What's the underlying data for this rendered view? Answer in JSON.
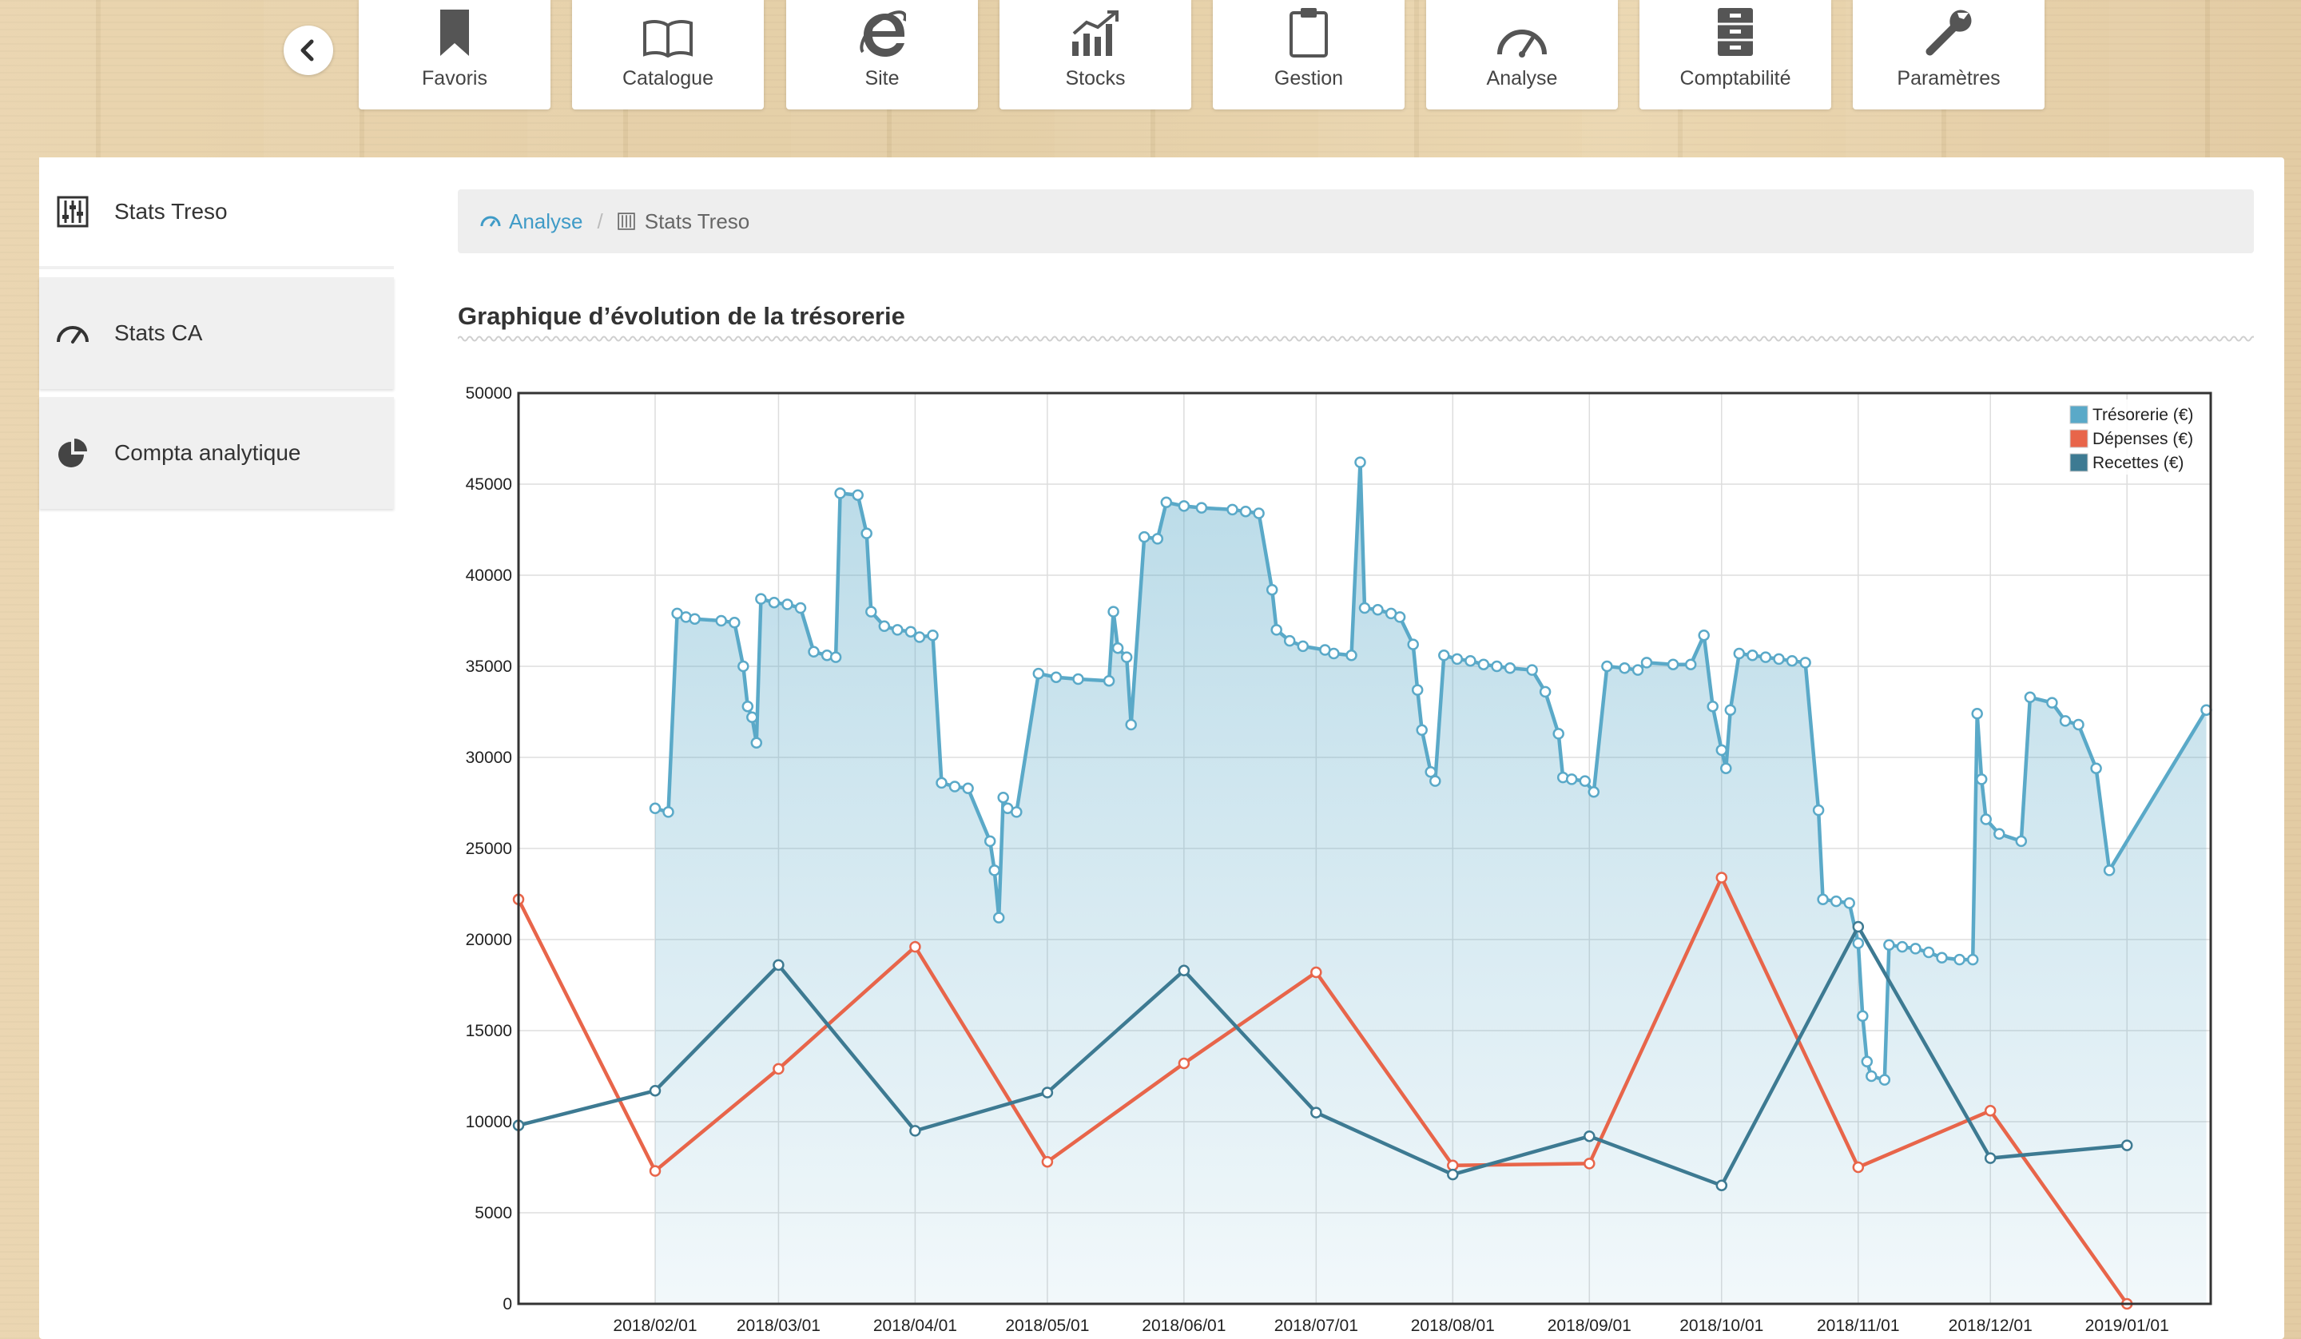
{
  "topnav": {
    "items": [
      {
        "label": "Favoris",
        "icon": "bookmark-icon"
      },
      {
        "label": "Catalogue",
        "icon": "book-icon"
      },
      {
        "label": "Site",
        "icon": "internet-explorer-icon"
      },
      {
        "label": "Stocks",
        "icon": "bar-chart-rising-icon"
      },
      {
        "label": "Gestion",
        "icon": "clipboard-icon"
      },
      {
        "label": "Analyse",
        "icon": "gauge-icon"
      },
      {
        "label": "Comptabilité",
        "icon": "archive-cabinet-icon"
      },
      {
        "label": "Paramètres",
        "icon": "wrench-icon"
      }
    ]
  },
  "sidebar": {
    "items": [
      {
        "label": "Stats Treso",
        "icon": "sliders-icon",
        "active": true
      },
      {
        "label": "Stats CA",
        "icon": "gauge-icon",
        "active": false
      },
      {
        "label": "Compta analytique",
        "icon": "pie-chart-icon",
        "active": false
      }
    ]
  },
  "breadcrumb": {
    "parent": "Analyse",
    "separator": "/",
    "current": "Stats Treso"
  },
  "section": {
    "title": "Graphique d’évolution de la trésorerie"
  },
  "colors": {
    "tresorerie": "#5aa9c8",
    "depenses": "#e8654a",
    "recettes": "#3d7a92",
    "link": "#3f9bc7"
  },
  "chart_data": {
    "type": "line",
    "x_axis_type": "date",
    "xlim": [
      "2018-01-01",
      "2019-01-20"
    ],
    "ylim": [
      0,
      50000
    ],
    "yticks": [
      0,
      5000,
      10000,
      15000,
      20000,
      25000,
      30000,
      35000,
      40000,
      45000,
      50000
    ],
    "xtick_labels": [
      "2018/02/01",
      "2018/03/01",
      "2018/04/01",
      "2018/05/01",
      "2018/06/01",
      "2018/07/01",
      "2018/08/01",
      "2018/09/01",
      "2018/10/01",
      "2018/11/01",
      "2018/12/01",
      "2019/01/01"
    ],
    "grid": true,
    "legend_position": "top-right",
    "series": [
      {
        "name": "Trésorerie (€)",
        "style": "area",
        "points": [
          [
            "2018-02-01",
            27200
          ],
          [
            "2018-02-04",
            27000
          ],
          [
            "2018-02-06",
            37900
          ],
          [
            "2018-02-08",
            37700
          ],
          [
            "2018-02-10",
            37600
          ],
          [
            "2018-02-16",
            37500
          ],
          [
            "2018-02-19",
            37400
          ],
          [
            "2018-02-21",
            35000
          ],
          [
            "2018-02-22",
            32800
          ],
          [
            "2018-02-23",
            32200
          ],
          [
            "2018-02-24",
            30800
          ],
          [
            "2018-02-25",
            38700
          ],
          [
            "2018-02-28",
            38500
          ],
          [
            "2018-03-03",
            38400
          ],
          [
            "2018-03-06",
            38200
          ],
          [
            "2018-03-09",
            35800
          ],
          [
            "2018-03-12",
            35600
          ],
          [
            "2018-03-14",
            35500
          ],
          [
            "2018-03-15",
            44500
          ],
          [
            "2018-03-19",
            44400
          ],
          [
            "2018-03-21",
            42300
          ],
          [
            "2018-03-22",
            38000
          ],
          [
            "2018-03-25",
            37200
          ],
          [
            "2018-03-28",
            37000
          ],
          [
            "2018-03-31",
            36900
          ],
          [
            "2018-04-02",
            36600
          ],
          [
            "2018-04-05",
            36700
          ],
          [
            "2018-04-07",
            28600
          ],
          [
            "2018-04-10",
            28400
          ],
          [
            "2018-04-13",
            28300
          ],
          [
            "2018-04-18",
            25400
          ],
          [
            "2018-04-19",
            23800
          ],
          [
            "2018-04-20",
            21200
          ],
          [
            "2018-04-21",
            27800
          ],
          [
            "2018-04-22",
            27200
          ],
          [
            "2018-04-24",
            27000
          ],
          [
            "2018-04-29",
            34600
          ],
          [
            "2018-05-03",
            34400
          ],
          [
            "2018-05-08",
            34300
          ],
          [
            "2018-05-15",
            34200
          ],
          [
            "2018-05-16",
            38000
          ],
          [
            "2018-05-17",
            36000
          ],
          [
            "2018-05-19",
            35500
          ],
          [
            "2018-05-20",
            31800
          ],
          [
            "2018-05-23",
            42100
          ],
          [
            "2018-05-26",
            42000
          ],
          [
            "2018-05-28",
            44000
          ],
          [
            "2018-06-01",
            43800
          ],
          [
            "2018-06-05",
            43700
          ],
          [
            "2018-06-12",
            43600
          ],
          [
            "2018-06-15",
            43500
          ],
          [
            "2018-06-18",
            43400
          ],
          [
            "2018-06-21",
            39200
          ],
          [
            "2018-06-22",
            37000
          ],
          [
            "2018-06-25",
            36400
          ],
          [
            "2018-06-28",
            36100
          ],
          [
            "2018-07-03",
            35900
          ],
          [
            "2018-07-05",
            35700
          ],
          [
            "2018-07-09",
            35600
          ],
          [
            "2018-07-11",
            46200
          ],
          [
            "2018-07-12",
            38200
          ],
          [
            "2018-07-15",
            38100
          ],
          [
            "2018-07-18",
            37900
          ],
          [
            "2018-07-20",
            37700
          ],
          [
            "2018-07-23",
            36200
          ],
          [
            "2018-07-24",
            33700
          ],
          [
            "2018-07-25",
            31500
          ],
          [
            "2018-07-27",
            29200
          ],
          [
            "2018-07-28",
            28700
          ],
          [
            "2018-07-30",
            35600
          ],
          [
            "2018-08-02",
            35400
          ],
          [
            "2018-08-05",
            35300
          ],
          [
            "2018-08-08",
            35100
          ],
          [
            "2018-08-11",
            35000
          ],
          [
            "2018-08-14",
            34900
          ],
          [
            "2018-08-19",
            34800
          ],
          [
            "2018-08-22",
            33600
          ],
          [
            "2018-08-25",
            31300
          ],
          [
            "2018-08-26",
            28900
          ],
          [
            "2018-08-28",
            28800
          ],
          [
            "2018-08-31",
            28700
          ],
          [
            "2018-09-02",
            28100
          ],
          [
            "2018-09-05",
            35000
          ],
          [
            "2018-09-09",
            34900
          ],
          [
            "2018-09-12",
            34800
          ],
          [
            "2018-09-14",
            35200
          ],
          [
            "2018-09-20",
            35100
          ],
          [
            "2018-09-24",
            35100
          ],
          [
            "2018-09-27",
            36700
          ],
          [
            "2018-09-29",
            32800
          ],
          [
            "2018-10-01",
            30400
          ],
          [
            "2018-10-02",
            29400
          ],
          [
            "2018-10-03",
            32600
          ],
          [
            "2018-10-05",
            35700
          ],
          [
            "2018-10-08",
            35600
          ],
          [
            "2018-10-11",
            35500
          ],
          [
            "2018-10-14",
            35400
          ],
          [
            "2018-10-17",
            35300
          ],
          [
            "2018-10-20",
            35200
          ],
          [
            "2018-10-23",
            27100
          ],
          [
            "2018-10-24",
            22200
          ],
          [
            "2018-10-27",
            22100
          ],
          [
            "2018-10-30",
            22000
          ],
          [
            "2018-11-01",
            19800
          ],
          [
            "2018-11-02",
            15800
          ],
          [
            "2018-11-03",
            13300
          ],
          [
            "2018-11-04",
            12500
          ],
          [
            "2018-11-07",
            12300
          ],
          [
            "2018-11-08",
            19700
          ],
          [
            "2018-11-11",
            19600
          ],
          [
            "2018-11-14",
            19500
          ],
          [
            "2018-11-17",
            19300
          ],
          [
            "2018-11-20",
            19000
          ],
          [
            "2018-11-24",
            18900
          ],
          [
            "2018-11-27",
            18900
          ],
          [
            "2018-11-28",
            32400
          ],
          [
            "2018-11-29",
            28800
          ],
          [
            "2018-11-30",
            26600
          ],
          [
            "2018-12-03",
            25800
          ],
          [
            "2018-12-08",
            25400
          ],
          [
            "2018-12-10",
            33300
          ],
          [
            "2018-12-15",
            33000
          ],
          [
            "2018-12-18",
            32000
          ],
          [
            "2018-12-21",
            31800
          ],
          [
            "2018-12-25",
            29400
          ],
          [
            "2018-12-28",
            23800
          ],
          [
            "2019-01-19",
            32600
          ]
        ]
      },
      {
        "name": "Dépenses (€)",
        "style": "line",
        "points": [
          [
            "2018-01-01",
            22200
          ],
          [
            "2018-02-01",
            7300
          ],
          [
            "2018-03-01",
            12900
          ],
          [
            "2018-04-01",
            19600
          ],
          [
            "2018-05-01",
            7800
          ],
          [
            "2018-06-01",
            13200
          ],
          [
            "2018-07-01",
            18200
          ],
          [
            "2018-08-01",
            7600
          ],
          [
            "2018-09-01",
            7700
          ],
          [
            "2018-10-01",
            23400
          ],
          [
            "2018-11-01",
            7500
          ],
          [
            "2018-12-01",
            10600
          ],
          [
            "2019-01-01",
            0
          ]
        ]
      },
      {
        "name": "Recettes (€)",
        "style": "line",
        "points": [
          [
            "2018-01-01",
            9800
          ],
          [
            "2018-02-01",
            11700
          ],
          [
            "2018-03-01",
            18600
          ],
          [
            "2018-04-01",
            9500
          ],
          [
            "2018-05-01",
            11600
          ],
          [
            "2018-06-01",
            18300
          ],
          [
            "2018-07-01",
            10500
          ],
          [
            "2018-08-01",
            7100
          ],
          [
            "2018-09-01",
            9200
          ],
          [
            "2018-10-01",
            6500
          ],
          [
            "2018-11-01",
            20700
          ],
          [
            "2018-12-01",
            8000
          ],
          [
            "2019-01-01",
            8700
          ]
        ]
      }
    ]
  }
}
